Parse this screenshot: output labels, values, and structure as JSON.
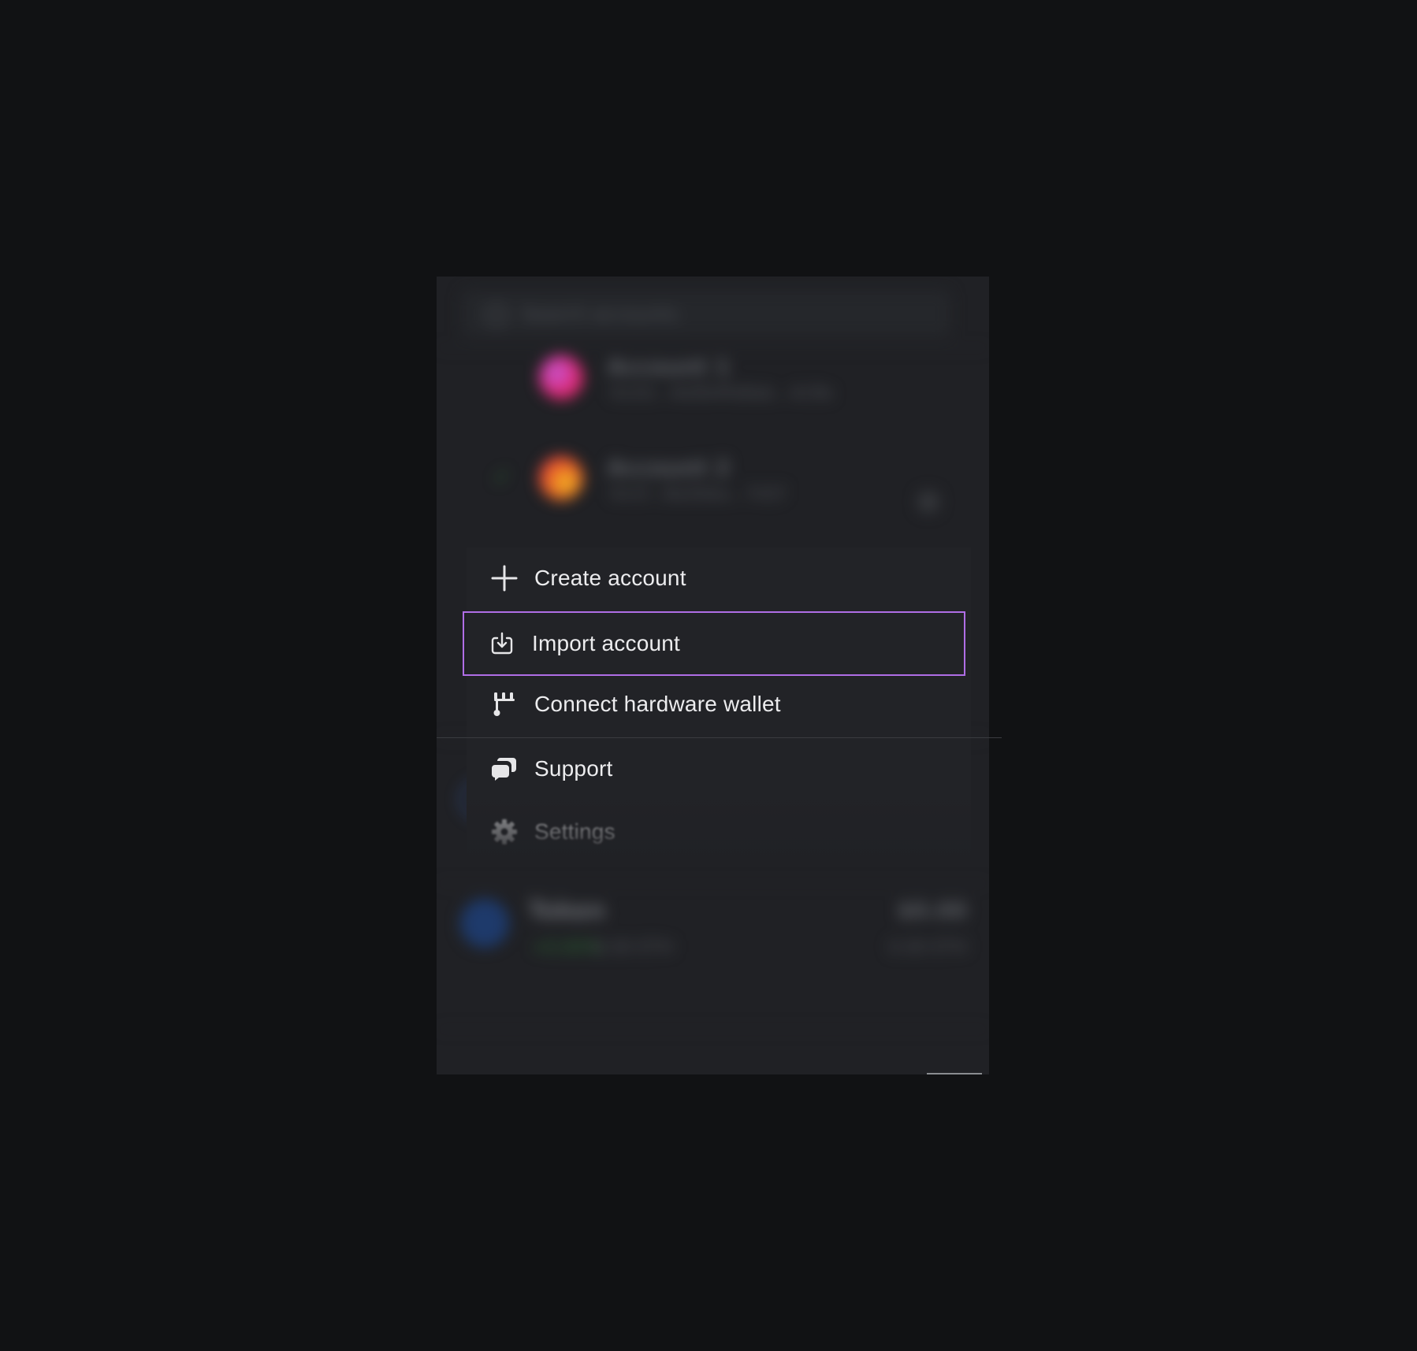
{
  "background": {
    "search_placeholder": "Search accounts",
    "accounts": [
      {
        "name": "Account 1",
        "address": "0x2d...4e0b4fe8ab...4c9e",
        "avatar_colors": [
          "#e0256e",
          "#c15ad9"
        ]
      },
      {
        "name": "Account 2",
        "address": "0x1f...8a2bba...7d1f",
        "avatar_colors": [
          "#e8542a",
          "#f0c020"
        ]
      }
    ],
    "token": {
      "name": "Token",
      "change": "+0.00%",
      "sub": "0.00 ETH",
      "value": "$0.00",
      "value_sub": "0.00 ETH"
    }
  },
  "menu": {
    "items": [
      {
        "label": "Create account",
        "icon": "plus-icon"
      },
      {
        "label": "Import account",
        "icon": "import-icon",
        "focused": true
      },
      {
        "label": "Connect hardware wallet",
        "icon": "hardware-wallet-icon"
      },
      {
        "label": "Support",
        "icon": "support-icon"
      },
      {
        "label": "Settings",
        "icon": "gear-icon"
      }
    ],
    "focus_color": "#b06ee6"
  },
  "colors": {
    "page_bg": "#111214",
    "panel_bg": "#202125",
    "menu_bg": "#222327",
    "text": "#ececee"
  }
}
